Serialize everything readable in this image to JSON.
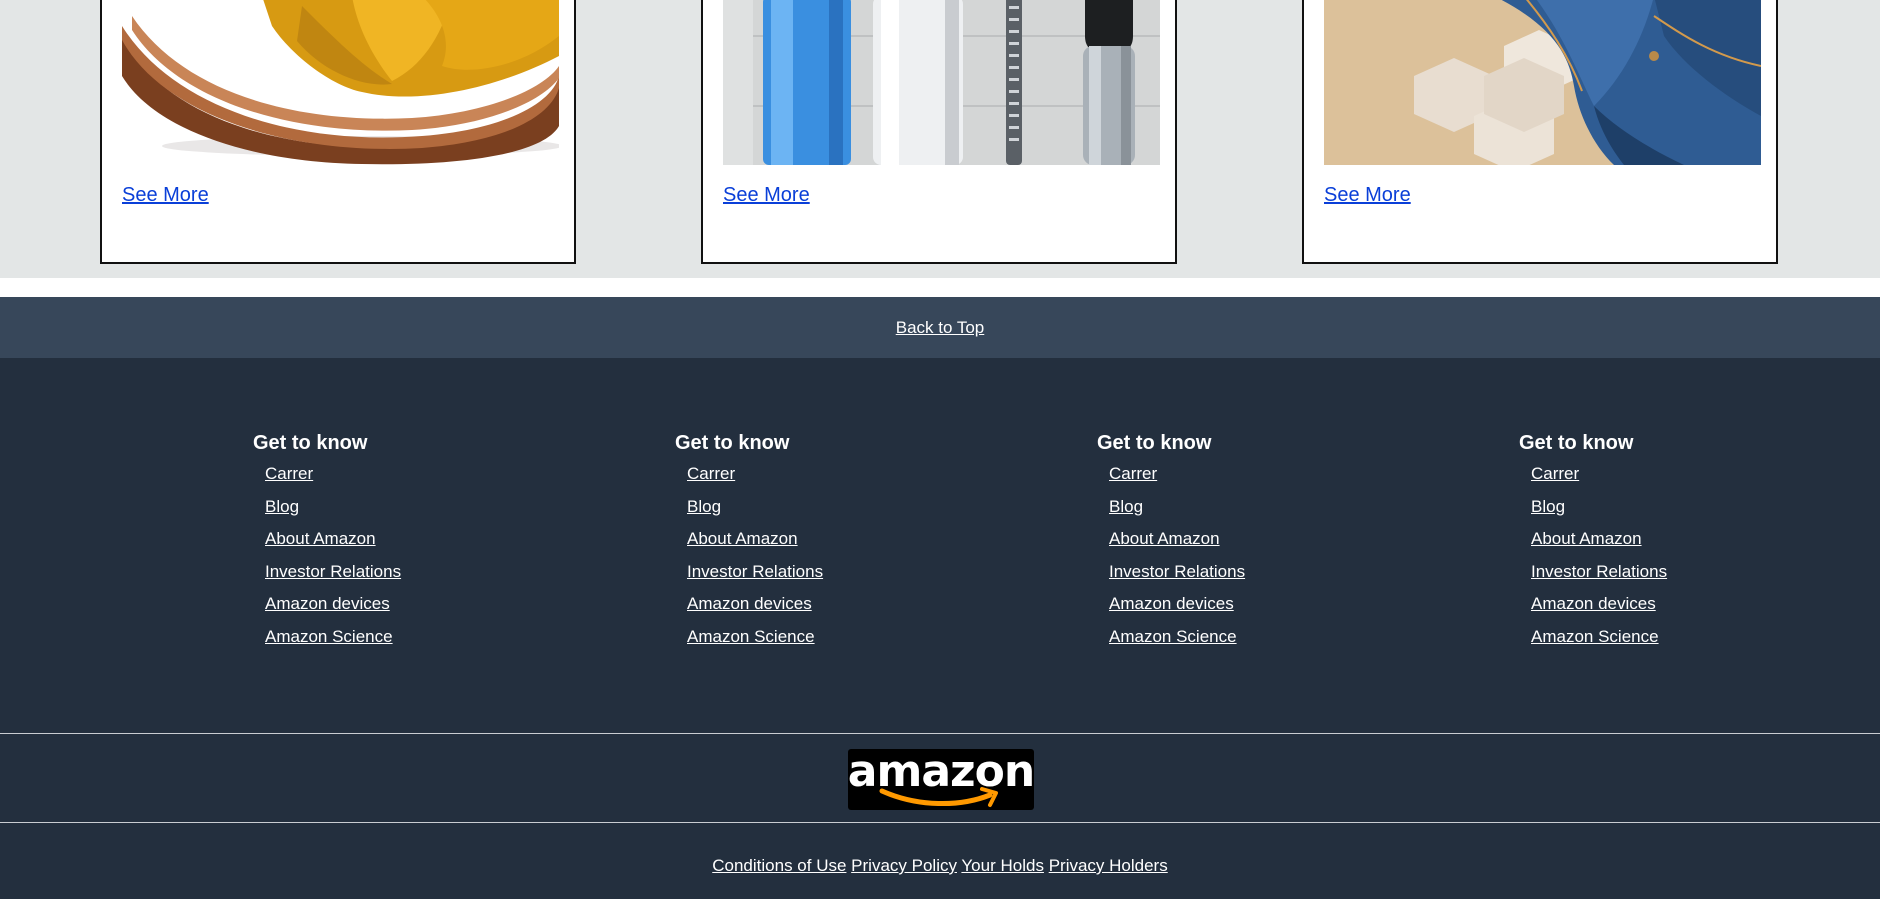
{
  "cards": [
    {
      "image": "sandal-photo",
      "link_label": "See More"
    },
    {
      "image": "grooming-products-photo",
      "link_label": "See More"
    },
    {
      "image": "jeans-photo",
      "link_label": "See More"
    }
  ],
  "back_to_top": {
    "label": "Back to Top"
  },
  "footer": {
    "columns": [
      {
        "heading": "Get to know",
        "links": [
          "Carrer",
          "Blog",
          "About Amazon",
          "Investor Relations",
          "Amazon devices",
          "Amazon Science"
        ]
      },
      {
        "heading": "Get to know",
        "links": [
          "Carrer",
          "Blog",
          "About Amazon",
          "Investor Relations",
          "Amazon devices",
          "Amazon Science"
        ]
      },
      {
        "heading": "Get to know",
        "links": [
          "Carrer",
          "Blog",
          "About Amazon",
          "Investor Relations",
          "Amazon devices",
          "Amazon Science"
        ]
      },
      {
        "heading": "Get to know",
        "links": [
          "Carrer",
          "Blog",
          "About Amazon",
          "Investor Relations",
          "Amazon devices",
          "Amazon Science"
        ]
      }
    ],
    "logo": {
      "text": "amazon",
      "icon": "amazon-smile-arrow"
    },
    "legal_links": [
      "Conditions of Use",
      "Privacy Policy",
      "Your Holds",
      "Privacy Holders"
    ]
  },
  "colors": {
    "band_bg": "#e3e6e6",
    "back_to_top_bg": "#37475a",
    "footer_bg": "#232f3e",
    "link_blue": "#0a3fd8",
    "smile_orange": "#ff9900"
  }
}
